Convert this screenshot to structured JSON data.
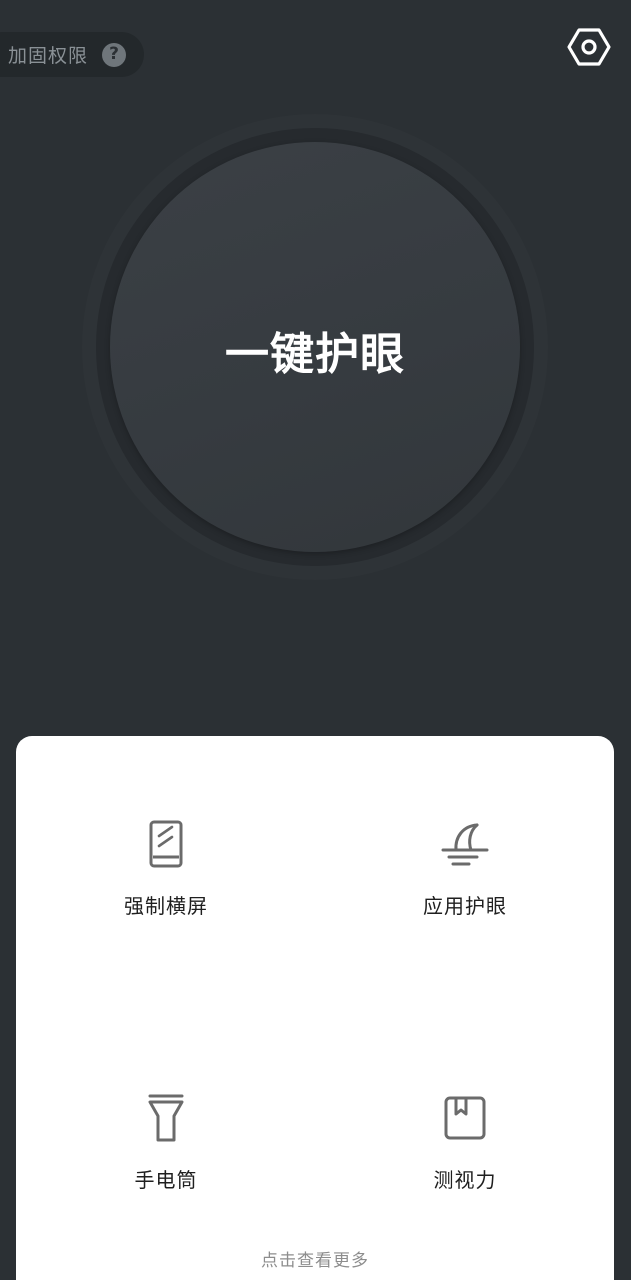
{
  "header": {
    "permission_label": "加固权限",
    "help_symbol": "?",
    "help_icon": "question-circle-icon",
    "settings_icon": "hexagon-gear-icon"
  },
  "main_button": {
    "label": "一键护眼"
  },
  "tools": {
    "items": [
      {
        "label": "强制横屏",
        "icon": "phone-rotate-icon"
      },
      {
        "label": "应用护眼",
        "icon": "moon-horizon-icon"
      },
      {
        "label": "手电筒",
        "icon": "flashlight-icon"
      },
      {
        "label": "测视力",
        "icon": "bookmark-book-icon"
      }
    ],
    "more_label": "点击查看更多"
  },
  "colors": {
    "background": "#2b3034",
    "circle": "#383d42",
    "card": "#ffffff",
    "icon_gray": "#6b6b6b",
    "muted_text": "#8a9196"
  }
}
